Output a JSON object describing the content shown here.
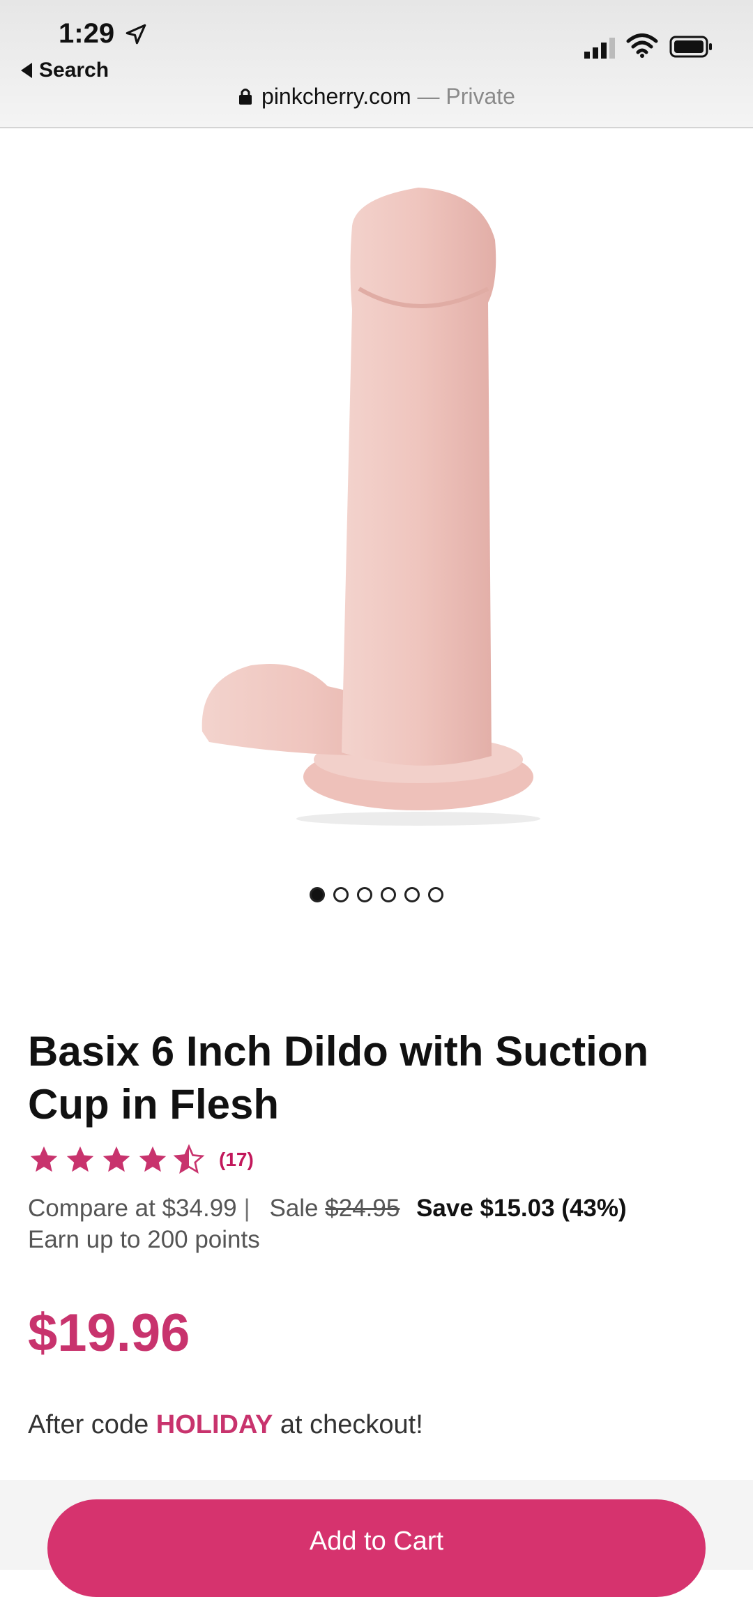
{
  "status_bar": {
    "time": "1:29",
    "back_label": "Search"
  },
  "browser": {
    "domain": "pinkcherry.com",
    "separator": " — ",
    "mode": "Private"
  },
  "gallery": {
    "current_index": 1,
    "total": 6
  },
  "product": {
    "title": "Basix 6 Inch Dildo with Suction Cup in Flesh",
    "rating_value": 4.5,
    "rating_max": 5,
    "review_count": "(17)",
    "compare_label": "Compare at $34.99",
    "separator": "|",
    "sale_label": "Sale",
    "sale_price": "$24.95",
    "save_label": "Save $15.03 (43%)",
    "points_label": "Earn up to 200 points",
    "final_price": "$19.96",
    "promo_prefix": "After code",
    "promo_code": "HOLIDAY",
    "promo_suffix": "at checkout!"
  },
  "cta": {
    "add_to_cart": "Add to Cart"
  },
  "colors": {
    "accent": "#d6336e",
    "price": "#c8336d",
    "product_flesh": "#f0c9c2"
  }
}
